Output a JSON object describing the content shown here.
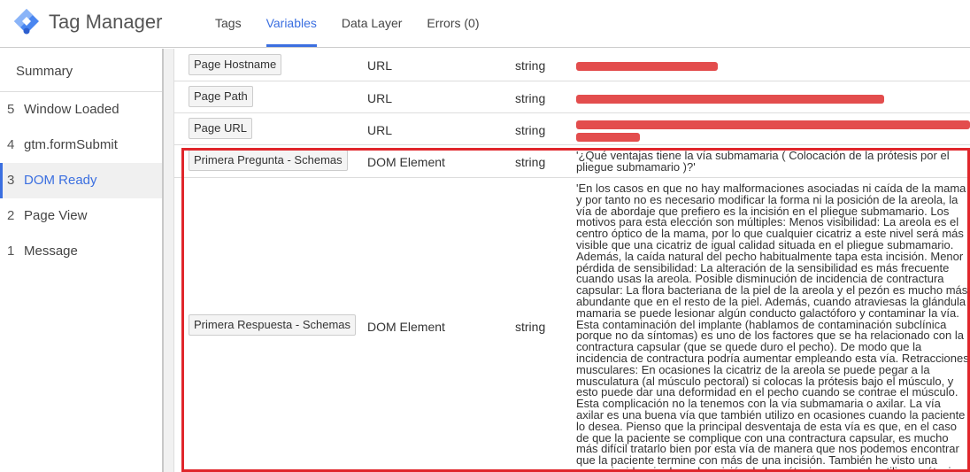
{
  "header": {
    "app_title": "Tag Manager",
    "logo_icon": "gtm-diamond-icon",
    "tabs": [
      {
        "label": "Tags",
        "active": false
      },
      {
        "label": "Variables",
        "active": true
      },
      {
        "label": "Data Layer",
        "active": false
      },
      {
        "label": "Errors (0)",
        "active": false
      }
    ]
  },
  "sidebar": {
    "summary_label": "Summary",
    "events": [
      {
        "num": "5",
        "label": "Window Loaded",
        "active": false
      },
      {
        "num": "4",
        "label": "gtm.formSubmit",
        "active": false
      },
      {
        "num": "3",
        "label": "DOM Ready",
        "active": true
      },
      {
        "num": "2",
        "label": "Page View",
        "active": false
      },
      {
        "num": "1",
        "label": "Message",
        "active": false
      }
    ]
  },
  "variables": [
    {
      "name": "Page Hostname",
      "type": "URL",
      "return_type": "string",
      "value": "[redacted]",
      "redacted": true
    },
    {
      "name": "Page Path",
      "type": "URL",
      "return_type": "string",
      "value": "[redacted]",
      "redacted": true
    },
    {
      "name": "Page URL",
      "type": "URL",
      "return_type": "string",
      "value": "[redacted]",
      "redacted": true
    },
    {
      "name": "Primera Pregunta - Schemas",
      "type": "DOM Element",
      "return_type": "string",
      "value": "'¿Qué ventajas tiene la vía submamaria ( Colocación de la prótesis por el pliegue submamario )?'",
      "redacted": false
    },
    {
      "name": "Primera Respuesta - Schemas",
      "type": "DOM Element",
      "return_type": "string",
      "value": "'En los casos en que no hay malformaciones asociadas ni caída de la mama y por tanto no es necesario modificar la forma ni la posición de la areola, la vía de abordaje que prefiero es la incisión en el pliegue submamario. Los motivos para esta elección son múltiples: Menos visibilidad: La areola es el centro óptico de la mama, por lo que cualquier cicatriz a este nivel será más visible que una cicatriz de igual calidad situada en el pliegue submamario. Además, la caída natural del pecho habitualmente tapa esta incisión. Menor pérdida de sensibilidad: La alteración de la sensibilidad es más frecuente cuando usas la areola. Posible disminución de incidencia de contractura capsular: La flora bacteriana de la piel de la areola y el pezón es mucho más abundante que en el resto de la piel. Además, cuando atraviesas la glándula mamaria se puede lesionar algún conducto galactóforo y contaminar la vía. Esta contaminación del implante (hablamos de contaminación subclínica porque no da síntomas) es uno de los factores que se ha relacionado con la contractura capsular (que se quede duro el pecho). De modo que la incidencia de contractura podría aumentar empleando esta vía. Retracciones musculares: En ocasiones la cicatriz de la areola se puede pegar a la musculatura (al músculo pectoral) si colocas la prótesis bajo el músculo, y esto puede dar una deformidad en el pecho cuando se contrae el músculo. Esta complicación no la tenemos con la vía submamaria o axilar. La vía axilar es una buena vía que también utilizo en ocasiones cuando la paciente lo desea. Pienso que la principal desventaja de esta vía es que, en el caso de que la paciente se complique con una contractura capsular, es mucho más difícil tratarlo bien por esta vía de manera que nos podemos encontrar que la paciente termine con más de una incisión. También he visto una mayor incidencia de mal posición de la prótesis en caso de utilizar prótesis anatómicas por vía axilar.'",
      "redacted": false
    }
  ],
  "colors": {
    "accent": "#3b6fe0",
    "highlight_border": "#e0262b"
  }
}
